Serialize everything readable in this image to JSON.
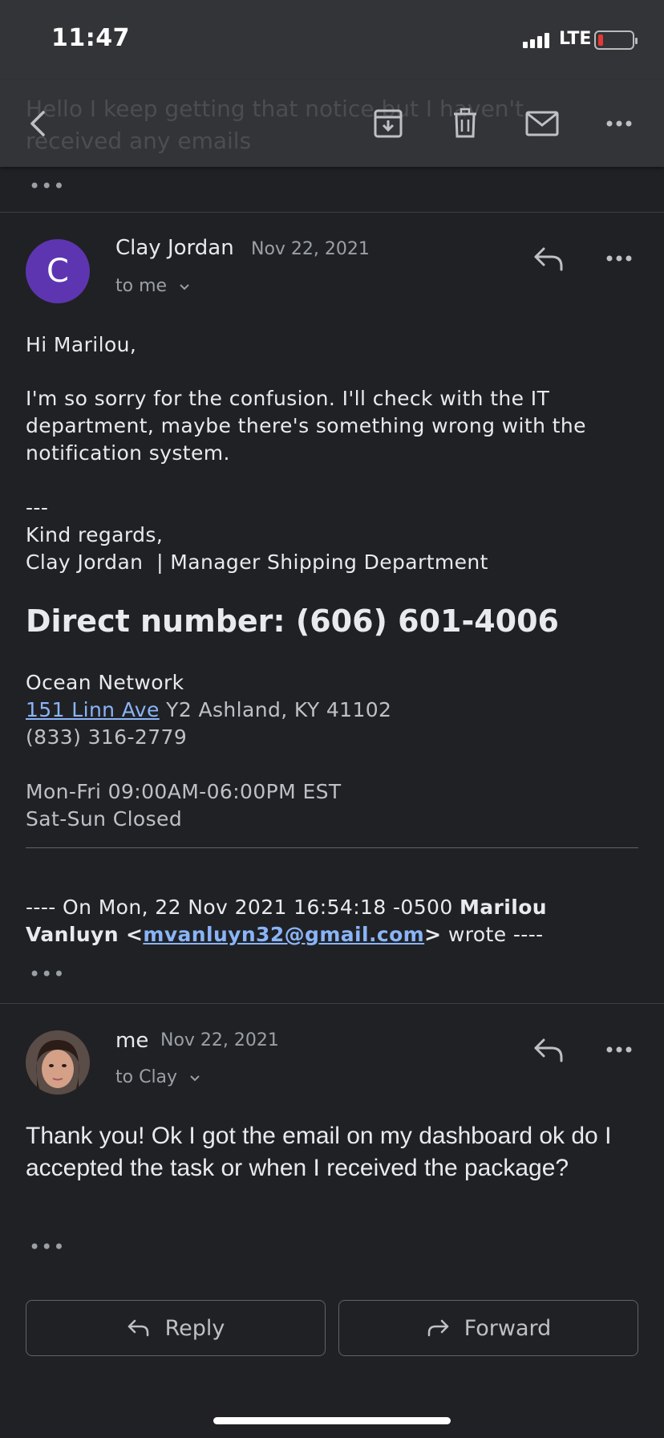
{
  "status_bar": {
    "time": "11:47",
    "network": "LTE"
  },
  "toolbar": {
    "ghost_subject": "Hello I keep getting that notice but I haven't received any emails",
    "icons": [
      "back-icon",
      "archive-icon",
      "trash-icon",
      "mail-icon",
      "more-icon"
    ]
  },
  "collapsed": {
    "dots": "•••"
  },
  "message1": {
    "avatar_letter": "C",
    "avatar_color": "#5e35b1",
    "sender": "Clay Jordan",
    "date": "Nov 22, 2021",
    "recipient": "to me",
    "greeting": "Hi Marilou,",
    "para": "I'm so sorry for the confusion. I'll check with the IT department, maybe there's something wrong with the notification system.",
    "sig_sep": "---",
    "regards": "Kind regards,",
    "sig_name": "Clay Jordan  | Manager Shipping Department",
    "direct": "Direct number: (606) 601-4006",
    "company": "Ocean Network",
    "address_link": "151 Linn Ave",
    "address_rest": " Y2 Ashland, KY 41102",
    "phone": "(833) 316-2779",
    "hours1": "Mon-Fri 09:00AM-06:00PM EST",
    "hours2": "Sat-Sun Closed",
    "quote_prefix": "---- On Mon, 22 Nov 2021 16:54:18 -0500 ",
    "quote_name": "Marilou Vanluyn",
    "quote_lt": " <",
    "quote_email": "mvanluyn32@gmail.com",
    "quote_gt": ">",
    "quote_suffix": " wrote ----",
    "dots": "•••"
  },
  "message2": {
    "sender": "me",
    "date": "Nov 22, 2021",
    "recipient": "to Clay",
    "text": "Thank you! Ok I got the email on my dashboard ok do I accepted the task or when I received the package?",
    "dots": "•••"
  },
  "actions": {
    "reply": "Reply",
    "forward": "Forward"
  }
}
